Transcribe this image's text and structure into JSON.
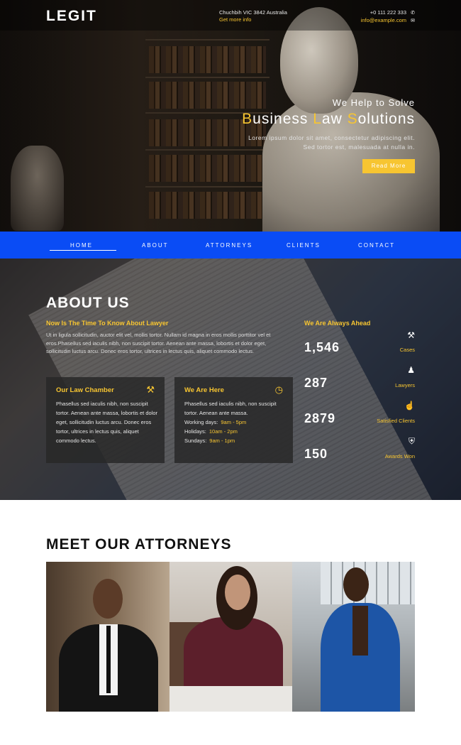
{
  "header": {
    "logo": "LEGIT",
    "address_line": "Chuchbih VIC 3842 Australia",
    "address_link": "Get more info",
    "phone": "+0 111 222 333",
    "email": "info@example.com"
  },
  "hero": {
    "subtitle": "We Help to Solve",
    "title_parts": [
      "B",
      "usiness ",
      "L",
      "aw ",
      "S",
      "olutions"
    ],
    "desc_line1": "Lorem ipsum dolor sit amet, consectetur adipiscing elit.",
    "desc_line2": "Sed tortor est, malesuada at nulla in.",
    "button": "Read More"
  },
  "nav": {
    "items": [
      "HOME",
      "ABOUT",
      "ATTORNEYS",
      "CLIENTS",
      "CONTACT"
    ]
  },
  "about": {
    "title": "ABOUT US",
    "subtitle": "Now Is The Time To Know About Lawyer",
    "paragraph": "Ut in ligula sollicitudin, auctor elit vel, mollis tortor. Nullam id magna in eros mollis porttitor vel et eros.Phasellus sed iaculis nibh, non suscipit tortor. Aenean ante massa, lobortis et dolor eget, sollicitudin luctus arcu. Donec eros tortor, ultrices in lectus quis, aliquet commodo lectus.",
    "chamber": {
      "title": "Our Law Chamber",
      "text": "Phasellus sed iaculis nibh, non suscipit tortor. Aenean ante massa, lobortis et dolor eget, sollicitudin luctus arcu. Donec eros tortor, ultrices in lectus quis, aliquet commodo lectus."
    },
    "here": {
      "title": "We Are Here",
      "text": "Phasellus sed iaculis nibh, non suscipit tortor. Aenean ante massa.",
      "rows": [
        {
          "day": "Working days",
          "time": "9am - 5pm"
        },
        {
          "day": "Holidays",
          "time": "10am - 2pm"
        },
        {
          "day": "Sundays",
          "time": "9am - 1pm"
        }
      ]
    },
    "ahead_title": "We Are Always Ahead",
    "stats": [
      {
        "value": "1,546",
        "label": "Cases",
        "icon": "gavel-icon"
      },
      {
        "value": "287",
        "label": "Lawyers",
        "icon": "users-icon"
      },
      {
        "value": "2879",
        "label": "Satisfied Clients",
        "icon": "thumbs-up-icon"
      },
      {
        "value": "150",
        "label": "Awards Won",
        "icon": "shield-icon"
      }
    ]
  },
  "attorneys": {
    "title": "MEET OUR ATTORNEYS"
  },
  "colors": {
    "accent": "#f7c531",
    "nav": "#0a4cf5"
  }
}
